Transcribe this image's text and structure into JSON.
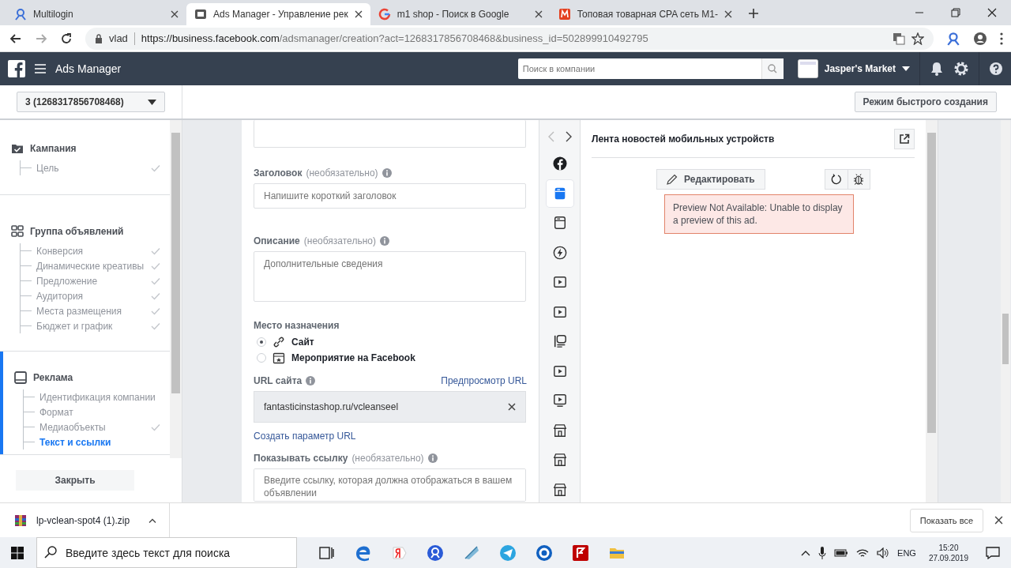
{
  "browser": {
    "tabs": [
      {
        "kind": "multilogin",
        "title": "Multilogin",
        "selected": false
      },
      {
        "kind": "ads",
        "title": "Ads Manager - Управление рек",
        "selected": true
      },
      {
        "kind": "google",
        "title": "m1 shop - Поиск в Google",
        "selected": false
      },
      {
        "kind": "m1",
        "title": "Топовая товарная CPA сеть M1-",
        "selected": false
      }
    ],
    "site_label": "vlad",
    "url_host": "https://business.facebook.com",
    "url_path": "/adsmanager/creation?act=1268317856708468&business_id=502899910492795"
  },
  "header": {
    "title": "Ads Manager",
    "search_placeholder": "Поиск в компании",
    "account": "Jasper's Market"
  },
  "account_selector": "3 (1268317856708468)",
  "quick_create": "Режим быстрого создания",
  "sidebar": {
    "sections": [
      {
        "kind": "campaign",
        "title": "Кампания",
        "selected": false,
        "children": [
          {
            "label": "Цель",
            "done": true,
            "selected": false
          }
        ]
      },
      {
        "kind": "adset",
        "title": "Группа объявлений",
        "selected": false,
        "children": [
          {
            "label": "Конверсия",
            "done": true,
            "selected": false
          },
          {
            "label": "Динамические креативы",
            "done": true,
            "selected": false
          },
          {
            "label": "Предложение",
            "done": true,
            "selected": false
          },
          {
            "label": "Аудитория",
            "done": true,
            "selected": false
          },
          {
            "label": "Места размещения",
            "done": true,
            "selected": false
          },
          {
            "label": "Бюджет и график",
            "done": true,
            "selected": false
          }
        ]
      },
      {
        "kind": "ad",
        "title": "Реклама",
        "selected": true,
        "children": [
          {
            "label": "Идентификация компании",
            "done": false,
            "selected": false
          },
          {
            "label": "Формат",
            "done": false,
            "selected": false
          },
          {
            "label": "Медиаобъекты",
            "done": true,
            "selected": false
          },
          {
            "label": "Текст и ссылки",
            "done": false,
            "selected": true
          }
        ]
      }
    ],
    "close_button": "Закрыть"
  },
  "form": {
    "headline": {
      "label": "Заголовок",
      "note": "(необязательно)",
      "placeholder": "Напишите короткий заголовок"
    },
    "description": {
      "label": "Описание",
      "note": "(необязательно)",
      "placeholder": "Дополнительные сведения"
    },
    "destination": {
      "label": "Место назначения",
      "options": [
        {
          "kind": "link",
          "label": "Сайт",
          "selected": true
        },
        {
          "kind": "event",
          "label": "Мероприятие на Facebook",
          "selected": false
        }
      ]
    },
    "website_url": {
      "label": "URL сайта",
      "preview_link": "Предпросмотр URL",
      "value": "fantasticinstashop.ru/vcleanseel"
    },
    "url_params_link": "Создать параметр URL",
    "display_link": {
      "label": "Показывать ссылку",
      "note": "(необязательно)",
      "placeholder": "Введите ссылку, которая должна отображаться в вашем объявлении"
    }
  },
  "placements": [
    {
      "kind": "facebook",
      "selected": false
    },
    {
      "kind": "feed",
      "selected": true
    },
    {
      "kind": "feed",
      "selected": false
    },
    {
      "kind": "instant",
      "selected": false
    },
    {
      "kind": "video",
      "selected": false
    },
    {
      "kind": "video",
      "selected": false
    },
    {
      "kind": "story",
      "selected": false
    },
    {
      "kind": "video",
      "selected": false
    },
    {
      "kind": "tv",
      "selected": false
    },
    {
      "kind": "shop",
      "selected": false
    },
    {
      "kind": "shop",
      "selected": false
    },
    {
      "kind": "shop",
      "selected": false
    }
  ],
  "preview": {
    "title": "Лента новостей мобильных устройств",
    "edit_button": "Редактировать",
    "error": "Preview Not Available: Unable to display a preview of this ad."
  },
  "downloads": {
    "file": "lp-vclean-spot4 (1).zip",
    "show_all": "Показать все"
  },
  "taskbar": {
    "search_placeholder": "Введите здесь текст для поиска",
    "language": "ENG",
    "time": "15:20",
    "date": "27.09.2019"
  }
}
